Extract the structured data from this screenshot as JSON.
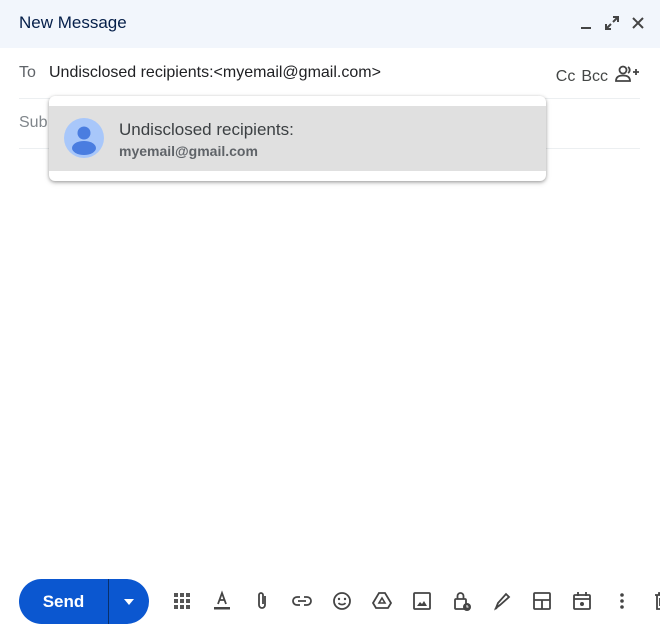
{
  "window": {
    "title": "New Message",
    "controls": [
      "minimize-icon",
      "expand-icon",
      "close-icon"
    ]
  },
  "recipients": {
    "to_label": "To",
    "to_value": "Undisclosed recipients:<myemail@gmail.com>",
    "cc_label": "Cc",
    "bcc_label": "Bcc",
    "add_contacts_icon": "person-add-icon"
  },
  "subject": {
    "label": "Sub"
  },
  "suggestion": {
    "name": "Undisclosed recipients:",
    "email": "myemail@gmail.com",
    "avatar_color": "#a8c7fa",
    "avatar_fg": "#4285f4"
  },
  "toolbar": {
    "send_label": "Send",
    "send_color": "#0b57d0",
    "tools": [
      "apps-icon",
      "text-format-icon",
      "attach-icon",
      "link-icon",
      "emoji-icon",
      "drive-icon",
      "image-icon",
      "confidential-icon",
      "signature-icon",
      "layout-icon",
      "schedule-icon",
      "more-options-icon",
      "trash-icon"
    ]
  }
}
